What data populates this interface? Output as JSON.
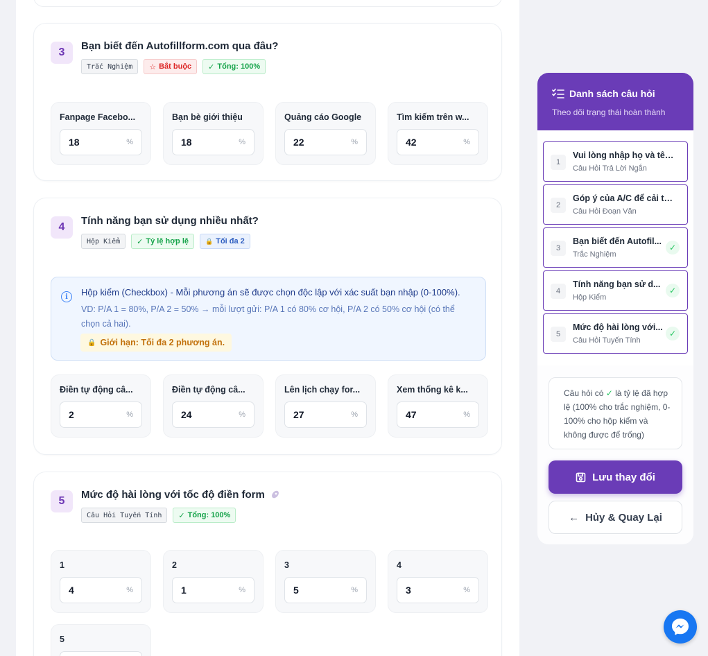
{
  "questions": [
    {
      "number": "3",
      "title": "Bạn biết đến Autofillform.com qua đâu?",
      "type_tag": "Trắc Nghiệm",
      "required_tag": "Bắt buộc",
      "status_tag": "Tổng: 100%",
      "options": [
        {
          "label": "Fanpage Facebo...",
          "value": "18",
          "unit": "%"
        },
        {
          "label": "Bạn bè giới thiệu",
          "value": "18",
          "unit": "%"
        },
        {
          "label": "Quảng cáo Google",
          "value": "22",
          "unit": "%"
        },
        {
          "label": "Tìm kiếm trên w...",
          "value": "42",
          "unit": "%"
        }
      ]
    },
    {
      "number": "4",
      "title": "Tính năng bạn sử dụng nhiều nhất?",
      "type_tag": "Hộp Kiểm",
      "status_tag": "Tỷ lệ hợp lệ",
      "limit_tag": "Tối đa 2",
      "info": {
        "title": "Hộp kiểm (Checkbox) - Mỗi phương án sẽ được chọn độc lập với xác suất bạn nhập (0-100%).",
        "description": "VD: P/A 1 = 80%, P/A 2 = 50% → mỗi lượt gửi: P/A 1 có 80% cơ hội, P/A 2 có 50% cơ hội (có thể chọn cả hai).",
        "warning": "Giới hạn: Tối đa 2 phương án."
      },
      "options": [
        {
          "label": "Điền tự động câ...",
          "value": "2",
          "unit": "%"
        },
        {
          "label": "Điền tự động câ...",
          "value": "24",
          "unit": "%"
        },
        {
          "label": "Lên lịch chạy for...",
          "value": "27",
          "unit": "%"
        },
        {
          "label": "Xem thống kê k...",
          "value": "47",
          "unit": "%"
        }
      ]
    },
    {
      "number": "5",
      "title": "Mức độ hài lòng với tốc độ điền form",
      "type_tag": "Câu Hỏi Tuyến Tính",
      "status_tag": "Tổng: 100%",
      "options": [
        {
          "label": "1",
          "value": "4",
          "unit": "%"
        },
        {
          "label": "2",
          "value": "1",
          "unit": "%"
        },
        {
          "label": "3",
          "value": "5",
          "unit": "%"
        },
        {
          "label": "4",
          "value": "3",
          "unit": "%"
        },
        {
          "label": "5",
          "value": "",
          "unit": "%"
        }
      ]
    }
  ],
  "sidebar": {
    "title": "Danh sách câu hỏi",
    "subtitle": "Theo dõi trạng thái hoàn thành",
    "items": [
      {
        "number": "1",
        "title": "Vui lòng nhập họ và tên...",
        "type": "Câu Hỏi Trả Lời Ngắn",
        "done": false
      },
      {
        "number": "2",
        "title": "Góp ý của A/C để cải th...",
        "type": "Câu Hỏi Đoạn Văn",
        "done": false
      },
      {
        "number": "3",
        "title": "Bạn biết đến Autofil...",
        "type": "Trắc Nghiệm",
        "done": true
      },
      {
        "number": "4",
        "title": "Tính năng bạn sử d...",
        "type": "Hộp Kiểm",
        "done": true
      },
      {
        "number": "5",
        "title": "Mức độ hài lòng với...",
        "type": "Câu Hỏi Tuyến Tính",
        "done": true
      }
    ],
    "note_before": "Câu hỏi có",
    "note_after": "là tỷ lệ đã hợp lệ (100% cho trắc nghiệm, 0-100% cho hộp kiểm và không được để trống)",
    "save_label": "Lưu thay đổi",
    "cancel_label": "Hủy & Quay Lại"
  },
  "colors": {
    "primary": "#6a3cb7",
    "success": "#22c55e",
    "danger": "#dc2626",
    "info": "#3b82f6",
    "warning": "#c2710c"
  },
  "icons": {
    "check": "✓",
    "star": "☆",
    "lock": "🔒",
    "arrow_left": "←"
  }
}
